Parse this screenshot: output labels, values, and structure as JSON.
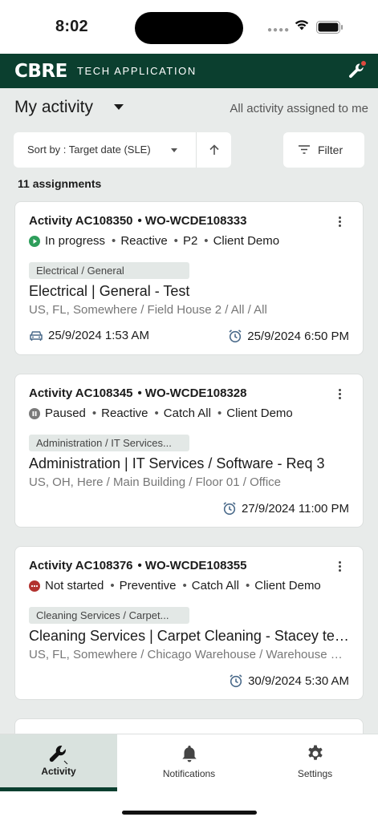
{
  "status_bar": {
    "time": "8:02"
  },
  "header": {
    "brand": "CBRE",
    "app_name": "TECH APPLICATION",
    "tool_icon": "wrench-notification-icon"
  },
  "page": {
    "title": "My activity",
    "scope": "All activity assigned to me"
  },
  "toolbar": {
    "sort_label": "Sort by : Target date (SLE)",
    "filter_label": "Filter"
  },
  "count_label": "11 assignments",
  "cards": [
    {
      "activity": "Activity AC108350",
      "work_order": "WO-WCDE108333",
      "status": "In progress",
      "status_color": "#2e9e5b",
      "status_icon": "play-icon",
      "type": "Reactive",
      "priority": "P2",
      "client": "Client Demo",
      "tag": "Electrical / General",
      "title": "Electrical | General - Test",
      "location": "US, FL, Somewhere / Field House 2 / All / All",
      "start": "25/9/2024 1:53 AM",
      "due": "25/9/2024 6:50 PM"
    },
    {
      "activity": "Activity AC108345",
      "work_order": "WO-WCDE108328",
      "status": "Paused",
      "status_color": "#7a7a7a",
      "status_icon": "pause-icon",
      "type": "Reactive",
      "priority": "Catch All",
      "client": "Client Demo",
      "tag": "Administration / IT Services...",
      "title": "Administration | IT Services / Software - Req 3",
      "location": "US, OH, Here / Main Building / Floor 01 / Office",
      "due": "27/9/2024 11:00 PM"
    },
    {
      "activity": "Activity AC108376",
      "work_order": "WO-WCDE108355",
      "status": "Not started",
      "status_color": "#b2322f",
      "status_icon": "ellipsis-icon",
      "type": "Preventive",
      "priority": "Catch All",
      "client": "Client Demo",
      "tag": "Cleaning Services / Carpet...",
      "title": "Cleaning Services | Carpet Cleaning - Stacey test f...",
      "location": "US, FL, Somewhere / Chicago Warehouse / Warehouse /...",
      "due": "30/9/2024 5:30 AM"
    }
  ],
  "nav": [
    {
      "label": "Activity",
      "icon": "wrench-icon",
      "active": true
    },
    {
      "label": "Notifications",
      "icon": "bell-icon",
      "active": false
    },
    {
      "label": "Settings",
      "icon": "gear-icon",
      "active": false
    }
  ],
  "colors": {
    "brand_green": "#0b3f2f",
    "background": "#e8ebea",
    "active_nav": "#d9e2de"
  }
}
